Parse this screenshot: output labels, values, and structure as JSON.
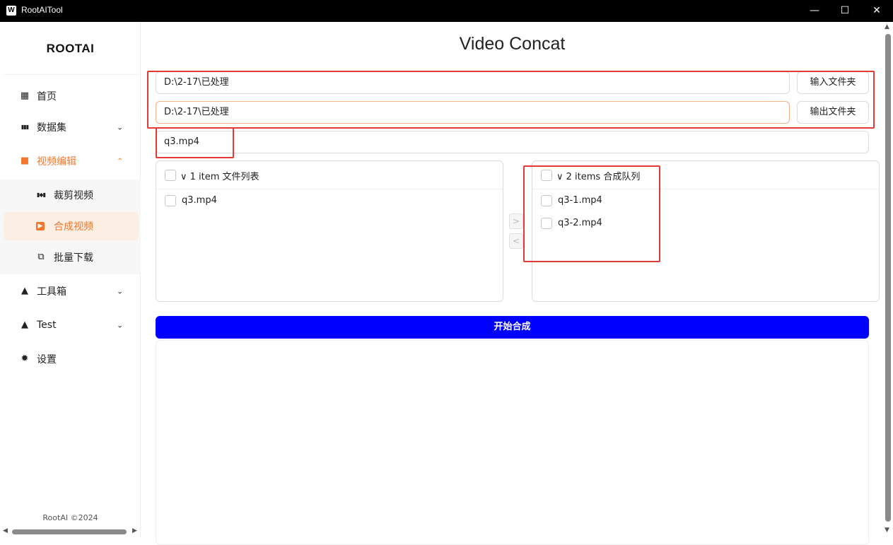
{
  "window": {
    "icon_letter": "W",
    "title": "RootAITool",
    "minimize_glyph": "—",
    "maximize_glyph": "☐",
    "close_glyph": "✕"
  },
  "sidebar": {
    "logo": "ROOTAI",
    "items": [
      {
        "label": "首页",
        "icon": "grid-icon",
        "glyph": "▦"
      },
      {
        "label": "数据集",
        "icon": "dataset-icon",
        "glyph": "▮▮▮",
        "chevron": "⌄"
      },
      {
        "label": "视频编辑",
        "icon": "video-icon",
        "glyph": "■",
        "chevron": "⌃"
      },
      {
        "label": "工具箱",
        "icon": "warning-icon",
        "glyph": "▲",
        "chevron": "⌄"
      },
      {
        "label": "Test",
        "icon": "warning-icon",
        "glyph": "▲",
        "chevron": "⌄"
      },
      {
        "label": "设置",
        "icon": "gear-icon",
        "glyph": "✹"
      }
    ],
    "subitems": [
      {
        "label": "裁剪视频",
        "icon": "scissors-icon",
        "glyph": "▮◆▮"
      },
      {
        "label": "合成视频",
        "icon": "play-icon",
        "glyph": "▶"
      },
      {
        "label": "批量下载",
        "icon": "download-icon",
        "glyph": "⧉"
      }
    ],
    "footer": "RootAI ©2024"
  },
  "main": {
    "title": "Video Concat",
    "input_path": "D:\\2-17\\已处理",
    "input_button": "输入文件夹",
    "output_path": "D:\\2-17\\已处理",
    "output_button": "输出文件夹",
    "selected_file": "q3.mp4",
    "left_panel": {
      "header": "∨ 1 item 文件列表",
      "items": [
        "q3.mp4"
      ]
    },
    "right_panel": {
      "header": "∨ 2 items 合成队列",
      "items": [
        "q3-1.mp4",
        "q3-2.mp4"
      ]
    },
    "move_right": ">",
    "move_left": "<",
    "start_button": "开始合成"
  },
  "colors": {
    "accent": "#f0772c",
    "primary_button": "#0000ff",
    "annotation": "#e53935"
  }
}
